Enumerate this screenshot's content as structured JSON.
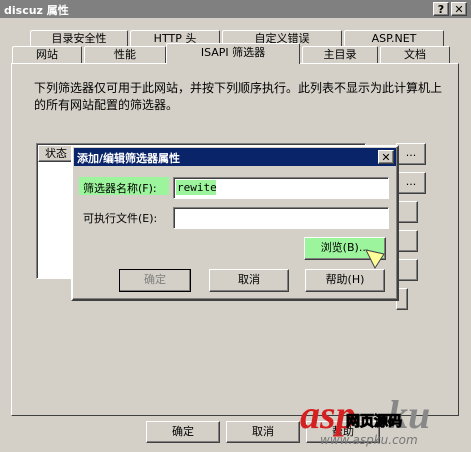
{
  "window": {
    "title": "discuz 属性",
    "help_glyph": "?",
    "close_glyph": "✕"
  },
  "tabs_back": [
    "目录安全性",
    "HTTP 头",
    "自定义错误",
    "ASP.NET"
  ],
  "tabs_front": [
    "网站",
    "性能",
    "ISAPI 筛选器",
    "主目录",
    "文档"
  ],
  "description": "下列筛选器仅可用于此网站，并按下列顺序执行。此列表不显示为此计算机上的所有网站配置的筛选器。",
  "filter_list": {
    "column_status": "状态"
  },
  "side_buttons": [
    "...",
    "..."
  ],
  "dialog": {
    "title": "添加/编辑筛选器属性",
    "close_glyph": "✕",
    "filter_name_label": "筛选器名称(F):",
    "filter_name_value": "rewite",
    "executable_label": "可执行文件(E):",
    "executable_value": "",
    "browse_label": "浏览(B)...",
    "ok_label": "确定",
    "cancel_label": "取消",
    "help_label": "帮助(H)"
  },
  "main_buttons": {
    "ok_label": "确定",
    "cancel_label": "取消",
    "help_label": "帮助"
  },
  "watermark": {
    "brand": "asp",
    "brand_suffix": "ku",
    "sub": "网页源码",
    "url": "www.aspku.com"
  },
  "colors": {
    "highlight_green": "#9cf59c",
    "dialog_title_bg": "#0a246a"
  }
}
